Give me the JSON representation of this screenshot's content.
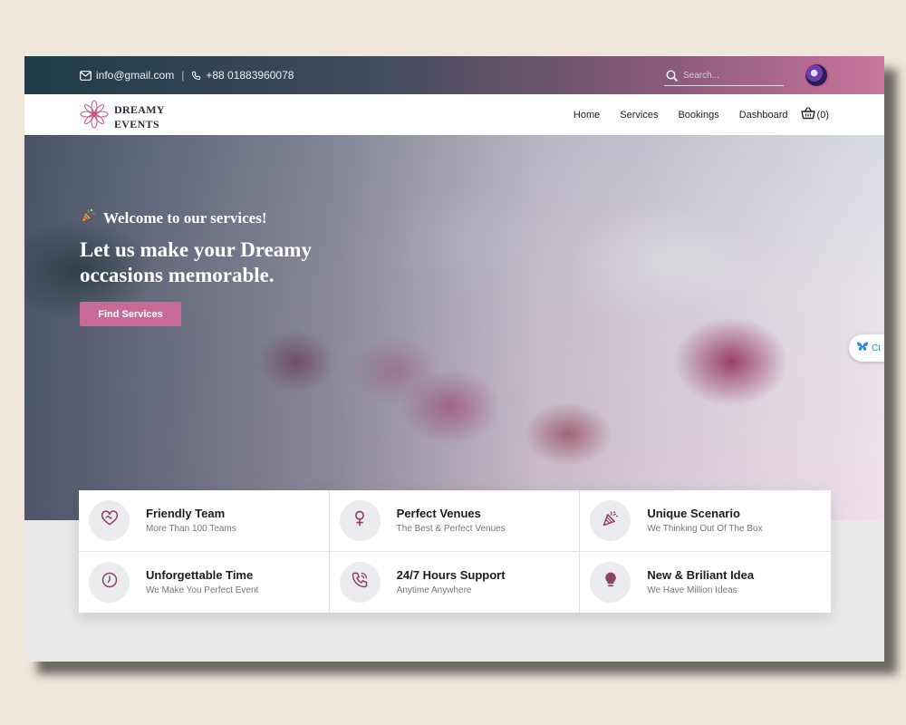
{
  "topbar": {
    "email": "info@gmail.com",
    "separator": "|",
    "phone": "+88 01883960078",
    "search_placeholder": "Search..."
  },
  "brand": {
    "line1": "DREAMY",
    "line2": "EVENTS"
  },
  "nav": {
    "items": [
      "Home",
      "Services",
      "Bookings",
      "Dashboard"
    ],
    "cart_count": "(0)"
  },
  "hero": {
    "welcome": "Welcome to our services!",
    "headline": "Let us make your Dreamy occasions memorable.",
    "cta": "Find Services"
  },
  "chat_widget": {
    "label": "Ct"
  },
  "features": [
    {
      "title": "Friendly Team",
      "subtitle": "More Than 100 Teams",
      "icon": "heart-handshake-icon"
    },
    {
      "title": "Perfect Venues",
      "subtitle": "The Best & Perfect Venues",
      "icon": "female-symbol-icon"
    },
    {
      "title": "Unique Scenario",
      "subtitle": "We Thinking Out Of The Box",
      "icon": "party-popper-icon"
    },
    {
      "title": "Unforgettable Time",
      "subtitle": "We Make You Perfect Event",
      "icon": "clock-icon"
    },
    {
      "title": "24/7 Hours Support",
      "subtitle": "Anytime Anywhere",
      "icon": "phone-call-icon"
    },
    {
      "title": "New & Briliant Idea",
      "subtitle": "We Have Million Ideas",
      "icon": "lightbulb-icon"
    }
  ],
  "colors": {
    "accent": "#c86c97",
    "icon": "#8e4167",
    "topbar_start": "#1f3c49",
    "topbar_end": "#c9769c"
  }
}
